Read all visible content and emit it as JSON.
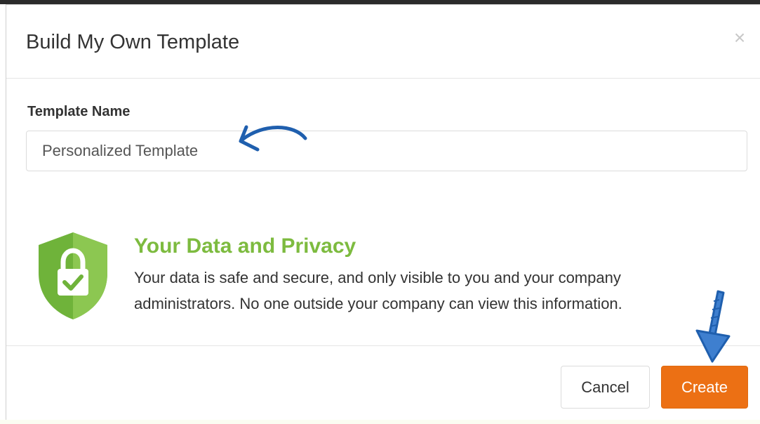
{
  "dialog": {
    "title": "Build My Own Template",
    "close_label": "×"
  },
  "form": {
    "template_name_label": "Template Name",
    "template_name_value": "Personalized Template"
  },
  "privacy": {
    "icon": "shield-lock-check-icon",
    "title": "Your Data and Privacy",
    "body": "Your data is safe and secure, and only visible to you and your company administrators. No one outside your company can view this information."
  },
  "footer": {
    "cancel_label": "Cancel",
    "create_label": "Create"
  },
  "colors": {
    "privacy_green": "#7dbb3f",
    "shield_green": "#6fb33a",
    "create_orange": "#ec7014",
    "annotation_blue": "#1f5fae"
  }
}
